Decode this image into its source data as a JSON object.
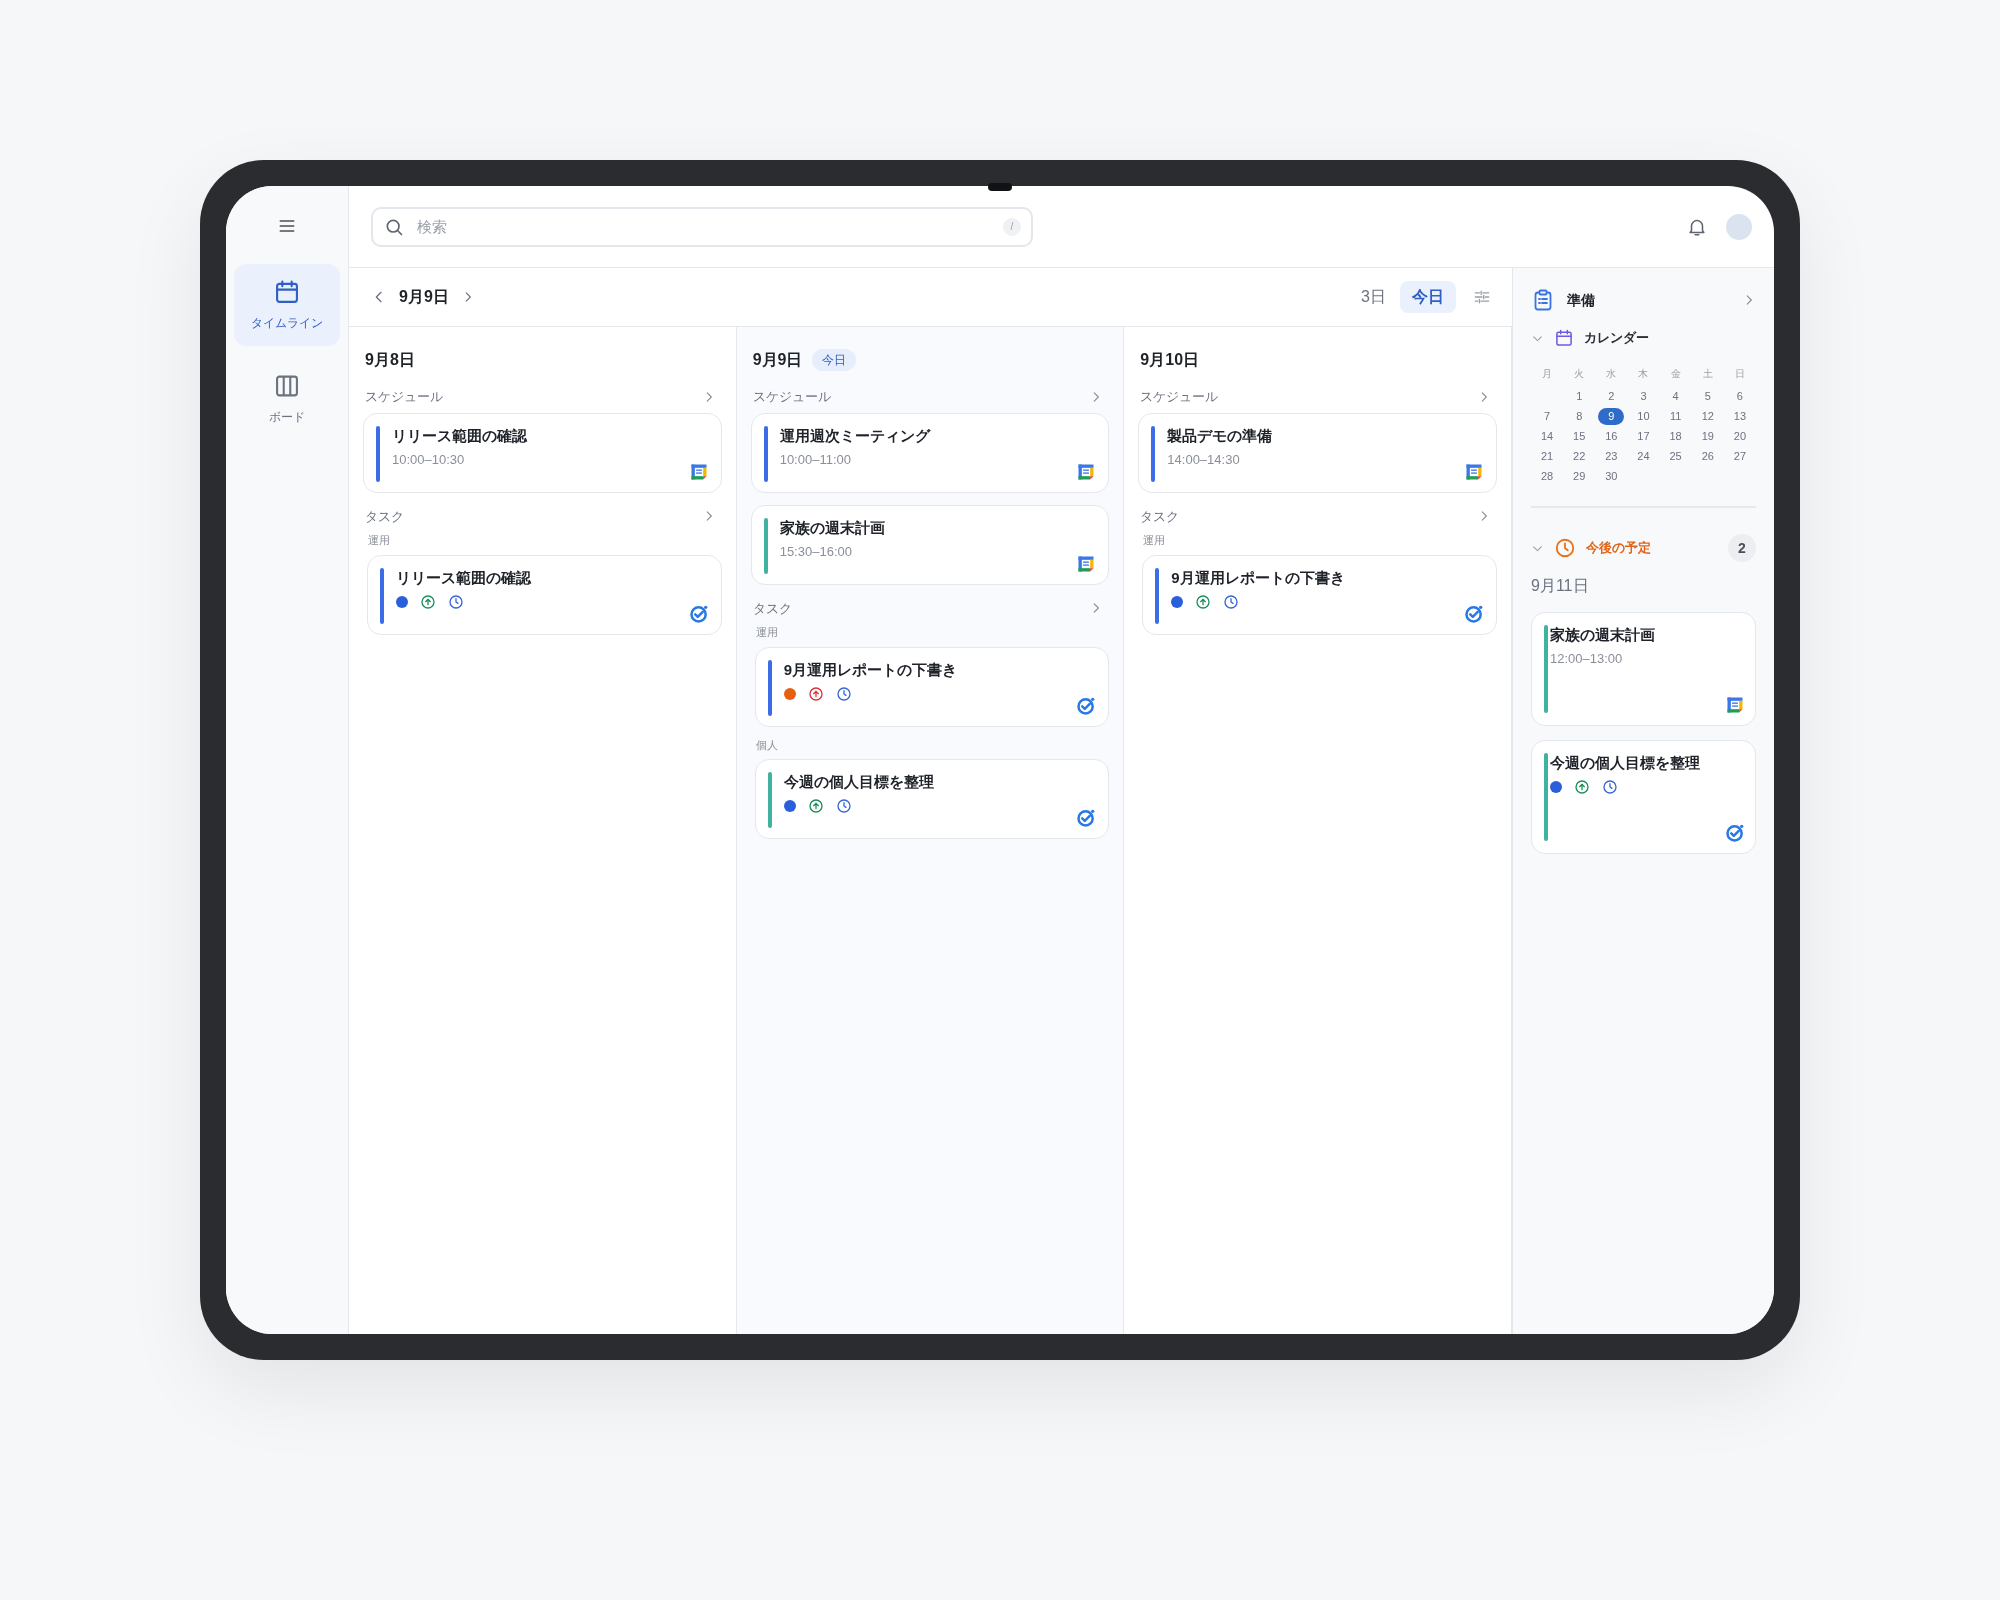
{
  "rail": {
    "items": [
      {
        "kind": "calendar",
        "label": "タイムライン",
        "selected": true
      },
      {
        "kind": "board",
        "label": "ボード",
        "selected": false
      }
    ]
  },
  "search": {
    "placeholder": "検索",
    "shortcut": "/"
  },
  "toolbar": {
    "date": "9月9日",
    "views": [
      {
        "label": "3日",
        "selected": false
      },
      {
        "label": "今日",
        "selected": true
      }
    ]
  },
  "days": [
    {
      "date": "9月8日",
      "schedule": {
        "label": "スケジュール",
        "events": [
          {
            "title": "リリース範囲の確認",
            "time": "10:00–10:30",
            "color": "#3b6ee6"
          }
        ]
      },
      "tasks": {
        "label": "タスク",
        "groups": [
          {
            "label": "運用",
            "items": [
              {
                "title": "リリース範囲の確認",
                "color": "#3b6ee6",
                "dot": {
                  "color": "#2a5fdc"
                },
                "arrow": {
                  "color": "#1e8f5a"
                }
              }
            ]
          }
        ]
      }
    },
    {
      "date": "9月9日",
      "badge": "今日",
      "schedule": {
        "label": "スケジュール",
        "events": [
          {
            "title": "運用週次ミーティング",
            "time": "10:00–11:00",
            "color": "#3b6ee6"
          },
          {
            "title": "家族の週末計画",
            "time": "15:30–16:00",
            "color": "#3fb2a0"
          }
        ]
      },
      "tasks": {
        "label": "タスク",
        "groups": [
          {
            "label": "運用",
            "items": [
              {
                "title": "9月運用レポートの下書き",
                "color": "#3b6ee6",
                "dot": {
                  "color": "#e8600f"
                },
                "arrow": {
                  "color": "#d9363e"
                }
              }
            ]
          },
          {
            "label": "個人",
            "items": [
              {
                "title": "今週の個人目標を整理",
                "color": "#3fb2a0",
                "dot": {
                  "color": "#2a5fdc"
                },
                "arrow": {
                  "color": "#1e8f5a"
                }
              }
            ]
          }
        ]
      }
    },
    {
      "date": "9月10日",
      "schedule": {
        "label": "スケジュール",
        "events": [
          {
            "title": "製品デモの準備",
            "time": "14:00–14:30",
            "color": "#3b6ee6"
          }
        ]
      },
      "tasks": {
        "label": "タスク",
        "groups": [
          {
            "label": "運用",
            "items": [
              {
                "title": "9月運用レポートの下書き",
                "color": "#3b6ee6",
                "dot": {
                  "color": "#2a5fdc"
                },
                "arrow": {
                  "color": "#1e8f5a"
                }
              }
            ]
          }
        ]
      }
    }
  ],
  "panel": {
    "title": "準備",
    "calendar": {
      "label": "カレンダー",
      "expanded": true,
      "weekdays": [
        "月",
        "火",
        "水",
        "木",
        "金",
        "土",
        "日"
      ],
      "weeks": [
        [
          {
            "d": "1",
            "selected": false
          },
          {
            "d": "2",
            "selected": false
          },
          {
            "d": "3",
            "selected": false
          },
          {
            "d": "4",
            "selected": false
          },
          {
            "d": "5",
            "selected": false
          },
          {
            "d": "6",
            "selected": false
          }
        ],
        [
          {
            "d": "7",
            "selected": false
          },
          {
            "d": "8",
            "selected": false
          },
          {
            "d": "9",
            "selected": true
          },
          {
            "d": "10",
            "selected": false
          },
          {
            "d": "11",
            "selected": false
          },
          {
            "d": "12",
            "selected": false
          },
          {
            "d": "13",
            "selected": false
          }
        ],
        [
          {
            "d": "14",
            "selected": false
          },
          {
            "d": "15",
            "selected": false
          },
          {
            "d": "16",
            "selected": false
          },
          {
            "d": "17",
            "selected": false
          },
          {
            "d": "18",
            "selected": false
          },
          {
            "d": "19",
            "selected": false
          },
          {
            "d": "20",
            "selected": false
          }
        ],
        [
          {
            "d": "21",
            "selected": false
          },
          {
            "d": "22",
            "selected": false
          },
          {
            "d": "23",
            "selected": false
          },
          {
            "d": "24",
            "selected": false
          },
          {
            "d": "25",
            "selected": false
          },
          {
            "d": "26",
            "selected": false
          },
          {
            "d": "27",
            "selected": false
          }
        ],
        [
          {
            "d": "28",
            "selected": false
          },
          {
            "d": "29",
            "selected": false
          },
          {
            "d": "30",
            "selected": false
          }
        ]
      ]
    },
    "upcoming": {
      "label": "今後の予定",
      "expanded": true,
      "count": "2",
      "date": "9月11日",
      "items": [
        {
          "kind": "event",
          "title": "家族の週末計画",
          "time": "12:00–13:00",
          "color": "#3fb2a0"
        },
        {
          "kind": "task",
          "title": "今週の個人目標を整理",
          "color": "#3fb2a0",
          "dot": {
            "color": "#2a5fdc"
          },
          "arrow": {
            "color": "#1e8f5a"
          }
        }
      ]
    }
  }
}
